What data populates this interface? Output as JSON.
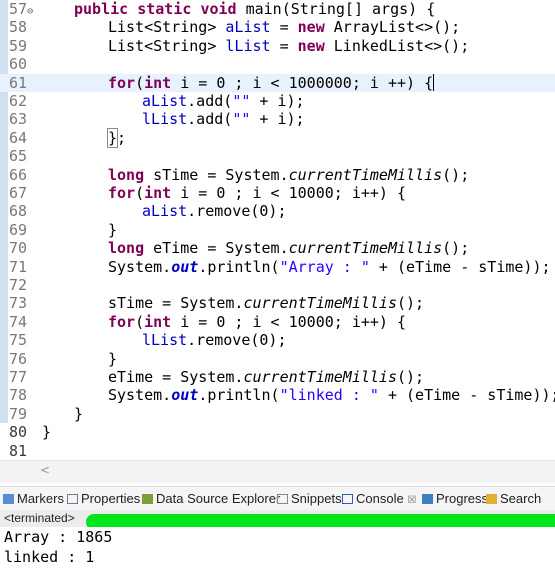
{
  "editor": {
    "lines": [
      {
        "num": "57",
        "marker": "⊖"
      },
      {
        "num": "58"
      },
      {
        "num": "59"
      },
      {
        "num": "60"
      },
      {
        "num": "61"
      },
      {
        "num": "62"
      },
      {
        "num": "63"
      },
      {
        "num": "64"
      },
      {
        "num": "65"
      },
      {
        "num": "66"
      },
      {
        "num": "67"
      },
      {
        "num": "68"
      },
      {
        "num": "69"
      },
      {
        "num": "70"
      },
      {
        "num": "71"
      },
      {
        "num": "72"
      },
      {
        "num": "73"
      },
      {
        "num": "74"
      },
      {
        "num": "75"
      },
      {
        "num": "76"
      },
      {
        "num": "77"
      },
      {
        "num": "78"
      },
      {
        "num": "79"
      },
      {
        "num": "80"
      },
      {
        "num": "81"
      }
    ],
    "code": {
      "l57": {
        "kw1": "public",
        "kw2": "static",
        "kw3": "void",
        "rest": "main(String[] args) {"
      },
      "l58": {
        "a": "List<String> ",
        "var": "aList",
        "b": " = ",
        "kw": "new",
        "c": " ArrayList<>();"
      },
      "l59": {
        "a": "List<String> ",
        "var": "lList",
        "b": " = ",
        "kw": "new",
        "c": " LinkedList<>();"
      },
      "l61": {
        "kw1": "for",
        "p1": "(",
        "kw2": "int",
        "rest": " i = 0 ; i < 1000000; i ++) {"
      },
      "l62": {
        "var": "aList",
        "a": ".add(",
        "s": "\"\"",
        "b": " + i);"
      },
      "l63": {
        "var": "lList",
        "a": ".add(",
        "s": "\"\"",
        "b": " + i);"
      },
      "l64": {
        "br": "}",
        "rest": ";"
      },
      "l66": {
        "kw": "long",
        "a": " sTime = System.",
        "m": "currentTimeMillis",
        "b": "();"
      },
      "l67": {
        "kw1": "for",
        "p1": "(",
        "kw2": "int",
        "rest": " i = 0 ; i < 10000; i++) {"
      },
      "l68": {
        "var": "aList",
        "a": ".remove(0);"
      },
      "l69": {
        "a": "}"
      },
      "l70": {
        "kw": "long",
        "a": " eTime = System.",
        "m": "currentTimeMillis",
        "b": "();"
      },
      "l71": {
        "a": "System.",
        "out": "out",
        "b": ".println(",
        "s": "\"Array : \"",
        "c": " + (eTime - sTime));"
      },
      "l73": {
        "a": "sTime = System.",
        "m": "currentTimeMillis",
        "b": "();"
      },
      "l74": {
        "kw1": "for",
        "p1": "(",
        "kw2": "int",
        "rest": " i = 0 ; i < 10000; i++) {"
      },
      "l75": {
        "var": "lList",
        "a": ".remove(0);"
      },
      "l76": {
        "a": "}"
      },
      "l77": {
        "a": "eTime = System.",
        "m": "currentTimeMillis",
        "b": "();"
      },
      "l78": {
        "a": "System.",
        "out": "out",
        "b": ".println(",
        "s": "\"linked : \"",
        "c": " + (eTime - sTime));"
      },
      "l79": {
        "a": "}"
      },
      "l80": {
        "a": "}"
      }
    }
  },
  "scrollbar": {
    "left_arrow": "<"
  },
  "views": {
    "tabs": [
      {
        "label": "Markers",
        "icon": "markers-icon"
      },
      {
        "label": "Properties",
        "icon": "properties-icon"
      },
      {
        "label": "Data Source Explorer",
        "icon": "data-source-icon"
      },
      {
        "label": "Snippets",
        "icon": "snippets-icon"
      },
      {
        "label": "Console",
        "icon": "console-icon",
        "close": "☒"
      },
      {
        "label": "Progress",
        "icon": "progress-icon"
      },
      {
        "label": "Search",
        "icon": "search-icon"
      }
    ]
  },
  "console": {
    "status": "<terminated>",
    "output": [
      "Array : 1865",
      "linked : 1"
    ]
  },
  "colors": {
    "keyword": "#7f0055",
    "field": "#0000c0",
    "string": "#2a00ff",
    "redaction": "#00e61a",
    "highlight": "#e8f2fe"
  }
}
